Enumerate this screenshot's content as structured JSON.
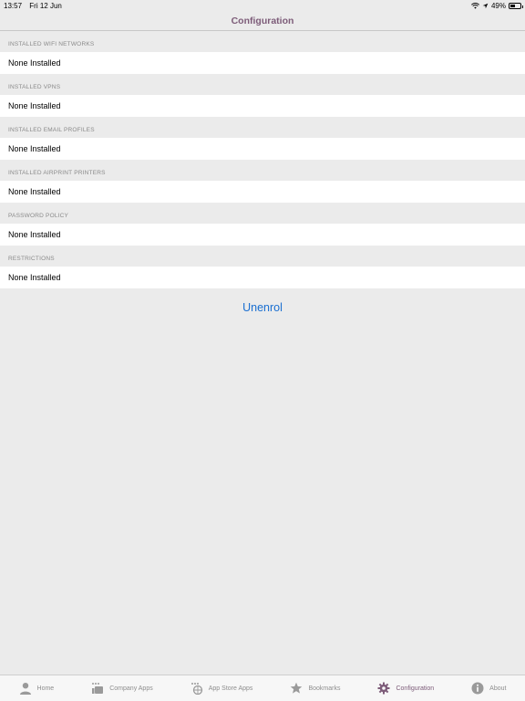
{
  "status": {
    "time": "13:57",
    "date": "Fri 12 Jun",
    "battery_percent": "49%",
    "battery_level": 0.49
  },
  "nav": {
    "title": "Configuration"
  },
  "sections": [
    {
      "header": "INSTALLED WIFI NETWORKS",
      "value": "None Installed"
    },
    {
      "header": "INSTALLED VPNS",
      "value": "None Installed"
    },
    {
      "header": "INSTALLED EMAIL PROFILES",
      "value": "None Installed"
    },
    {
      "header": "INSTALLED AIRPRINT PRINTERS",
      "value": "None Installed"
    },
    {
      "header": "PASSWORD POLICY",
      "value": "None Installed"
    },
    {
      "header": "RESTRICTIONS",
      "value": "None Installed"
    }
  ],
  "unenrol_label": "Unenrol",
  "tabs": [
    {
      "label": "Home",
      "icon": "person-icon"
    },
    {
      "label": "Company Apps",
      "icon": "company-apps-icon"
    },
    {
      "label": "App Store Apps",
      "icon": "app-store-apps-icon"
    },
    {
      "label": "Bookmarks",
      "icon": "star-icon"
    },
    {
      "label": "Configuration",
      "icon": "gear-icon",
      "active": true
    },
    {
      "label": "About",
      "icon": "info-icon"
    }
  ],
  "colors": {
    "accent": "#7d5c79",
    "link": "#1a6fd1"
  }
}
